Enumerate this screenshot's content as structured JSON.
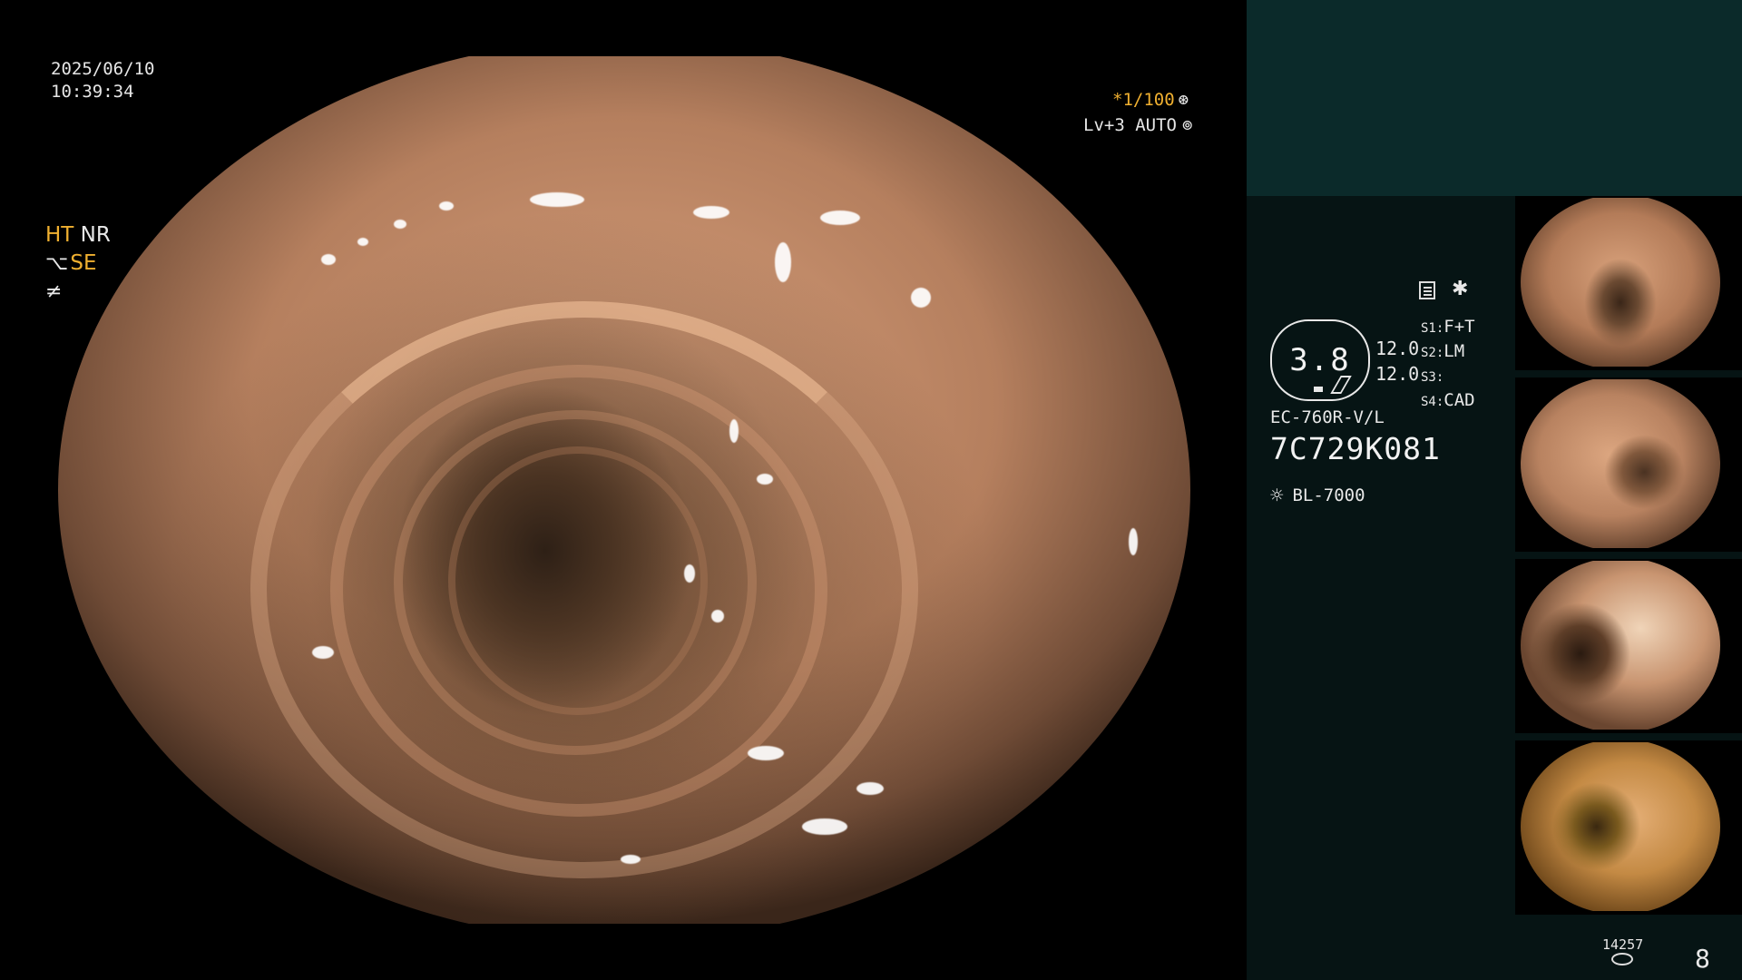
{
  "overlay": {
    "date": "2025/06/10",
    "time": "10:39:34",
    "shutter": "*1/100",
    "shutter_icon": "aperture-icon",
    "agc": "Lv+3 AUTO",
    "agc_icon": "iris-icon"
  },
  "panel": {
    "mode_ht": "HT",
    "mode_nr": "NR",
    "mode_se": "SE",
    "zoom": "3.8",
    "value_1": "12.0",
    "value_2": "12.0",
    "switches": [
      {
        "key": "S1:",
        "value": "F+T"
      },
      {
        "key": "S2:",
        "value": "LM"
      },
      {
        "key": "S3:",
        "value": ""
      },
      {
        "key": "S4:",
        "value": "CAD"
      }
    ],
    "scope_model": "EC-760R-V/L",
    "scope_serial": "7C729K081",
    "light_source": "BL-7000",
    "storage_count": "14257",
    "page_number": "8"
  },
  "colors": {
    "accent": "#f0b030",
    "panel_bg": "#061414",
    "panel_top": "#0b2a2a"
  }
}
